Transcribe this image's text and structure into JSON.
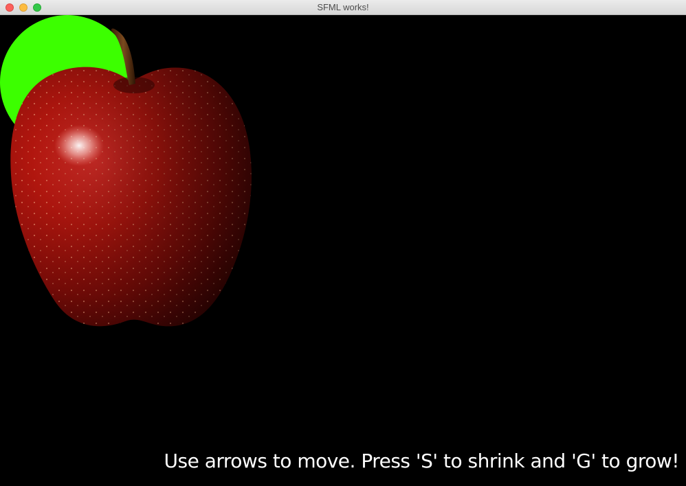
{
  "window": {
    "title": "SFML works!"
  },
  "scene": {
    "circle_color": "#3cff00",
    "sprite": "apple",
    "instructions": "Use arrows to move. Press 'S' to shrink and 'G' to grow!"
  }
}
